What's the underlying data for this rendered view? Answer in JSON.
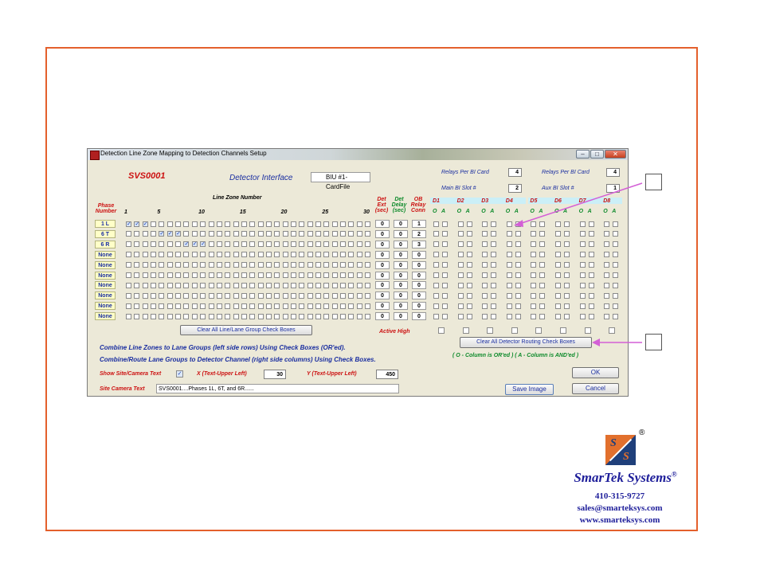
{
  "window": {
    "title": "Detection Line Zone Mapping to Detection Channels Setup",
    "buttons": {
      "minimize": "–",
      "maximize": "□",
      "close": "✕"
    }
  },
  "header": {
    "site_id": "SVS0001",
    "interface_label": "Detector Interface",
    "interface_value": "BIU #1-CardFile",
    "relays_per_bi_card_label": "Relays Per BI Card",
    "relays_per_bi_card_value": "4",
    "relays_per_bi_card_label2": "Relays Per BI Card",
    "relays_per_bi_card_value2": "4",
    "main_bi_slot_label": "Main BI Slot #",
    "main_bi_slot_value": "2",
    "aux_bi_slot_label": "Aux BI Slot #",
    "aux_bi_slot_value": "1"
  },
  "grid": {
    "phase_number_label": [
      "Phase",
      "Number"
    ],
    "line_zone_number_label": "Line Zone Number",
    "zone_ticks": [
      {
        "label": "1",
        "col": 1
      },
      {
        "label": "5",
        "col": 5
      },
      {
        "label": "10",
        "col": 10
      },
      {
        "label": "15",
        "col": 15
      },
      {
        "label": "20",
        "col": 20
      },
      {
        "label": "25",
        "col": 25
      },
      {
        "label": "30",
        "col": 30
      }
    ],
    "det_ext_label": [
      "Det",
      "Ext",
      "(sec)"
    ],
    "det_delay_label": [
      "Det",
      "Delay",
      "(sec)"
    ],
    "ob_relay_label": [
      "OB",
      "Relay",
      "Conn"
    ],
    "detectors": [
      "D1",
      "D2",
      "D3",
      "D4",
      "D5",
      "D6",
      "D7",
      "D8"
    ],
    "oa_label": [
      "O",
      "A"
    ],
    "rows": [
      {
        "phase": "1 L",
        "checked": [
          1,
          2,
          3
        ],
        "ext": "0",
        "delay": "0",
        "relay": "1"
      },
      {
        "phase": "6 T",
        "checked": [
          5,
          6,
          7
        ],
        "ext": "0",
        "delay": "0",
        "relay": "2"
      },
      {
        "phase": "6 R",
        "checked": [
          8,
          9,
          10
        ],
        "ext": "0",
        "delay": "0",
        "relay": "3"
      },
      {
        "phase": "None",
        "checked": [],
        "ext": "0",
        "delay": "0",
        "relay": "0"
      },
      {
        "phase": "None",
        "checked": [],
        "ext": "0",
        "delay": "0",
        "relay": "0"
      },
      {
        "phase": "None",
        "checked": [],
        "ext": "0",
        "delay": "0",
        "relay": "0"
      },
      {
        "phase": "None",
        "checked": [],
        "ext": "0",
        "delay": "0",
        "relay": "0"
      },
      {
        "phase": "None",
        "checked": [],
        "ext": "0",
        "delay": "0",
        "relay": "0"
      },
      {
        "phase": "None",
        "checked": [],
        "ext": "0",
        "delay": "0",
        "relay": "0"
      },
      {
        "phase": "None",
        "checked": [],
        "ext": "0",
        "delay": "0",
        "relay": "0"
      }
    ]
  },
  "controls": {
    "clear_lane_button": "Clear All Line/Lane Group Check Boxes",
    "active_high_label": "Active High",
    "clear_routing_button": "Clear All Detector Routing Check Boxes",
    "combine_line": "Combine Line Zones to Lane Groups (left side rows) Using Check Boxes (OR'ed).",
    "combine_route": "Combine/Route Lane Groups to Detector Channel (right side columns) Using Check Boxes.",
    "column_note": "( O - Column is OR'ed )  ( A - Column is AND'ed )",
    "show_site_label": "Show Site/Camera Text",
    "show_site_checked": "✓",
    "x_label": "X (Text-Upper Left)",
    "x_value": "30",
    "y_label": "Y (Text-Upper Left)",
    "y_value": "450",
    "site_camera_label": "Site Camera Text",
    "site_camera_value": "SVS0001....Phases 1L, 6T, and 6R......",
    "ok_button": "OK",
    "save_button": "Save Image",
    "cancel_button": "Cancel"
  },
  "logo": {
    "letter_top": "S",
    "letter_bottom": "S",
    "registered": "®",
    "company": "SmarTek Systems",
    "phone": "410-315-9727",
    "email": "sales@smarteksys.com",
    "website": "www.smarteksys.com"
  },
  "colors": {
    "frame": "#e4602c",
    "annotation_arrow": "#d35fd6",
    "label_red": "#cc1111",
    "label_blue": "#1a2ea0",
    "label_green": "#0c8a2a",
    "logo_blue": "#1e1e9a"
  }
}
